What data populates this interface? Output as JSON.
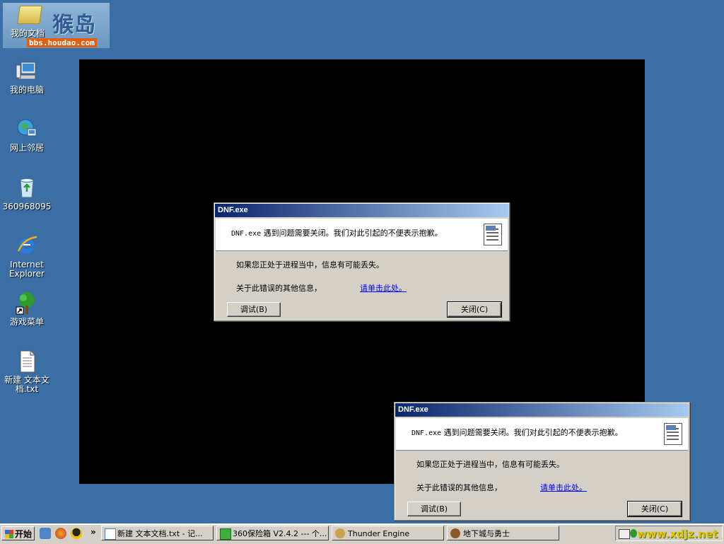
{
  "watermark": {
    "logo": "猴岛",
    "url": "bbs.houdao.com",
    "label": "我的文档"
  },
  "desktop_icons": [
    {
      "label": "我的电脑",
      "icon": "my-computer-icon"
    },
    {
      "label": "网上邻居",
      "icon": "network-places-icon"
    },
    {
      "label": "360968095",
      "icon": "recycle-bin-icon"
    },
    {
      "label": "Internet Explorer",
      "icon": "internet-explorer-icon"
    },
    {
      "label": "游戏菜单",
      "icon": "tree-shortcut-icon"
    },
    {
      "label": "新建 文本文档.txt",
      "icon": "text-document-icon"
    }
  ],
  "dialogs": [
    {
      "title": "DNF.exe",
      "message_exe": "DNF.exe",
      "message": " 遇到问题需要关闭。我们对此引起的不便表示抱歉。",
      "line1": "如果您正处于进程当中，信息有可能丢失。",
      "line2": "关于此错误的其他信息，",
      "link": "请单击此处。",
      "debug": "调试(B)",
      "close": "关闭(C)"
    },
    {
      "title": "DNF.exe",
      "message_exe": "DNF.exe",
      "message": " 遇到问题需要关闭。我们对此引起的不便表示抱歉。",
      "line1": "如果您正处于进程当中，信息有可能丢失。",
      "line2": "关于此错误的其他信息，",
      "link": "请单击此处。",
      "debug": "调试(B)",
      "close": "关闭(C)"
    }
  ],
  "taskbar": {
    "start": "开始",
    "chevron": "»",
    "tasks": [
      {
        "label": "新建 文本文档.txt - 记...",
        "icon": "notepad-icon"
      },
      {
        "label": "360保险箱 V2.4.2 --- 个...",
        "icon": "safe-360-icon"
      },
      {
        "label": "Thunder Engine",
        "icon": "thunder-engine-icon"
      },
      {
        "label": "地下城与勇士",
        "icon": "dnf-game-icon"
      }
    ],
    "tray_watermark": "www.xdjz.net"
  },
  "colors": {
    "desktop": "#3a6ea5",
    "titlebar_start": "#0a246a",
    "titlebar_end": "#a6caf0",
    "dialog_face": "#d4d0c8"
  }
}
